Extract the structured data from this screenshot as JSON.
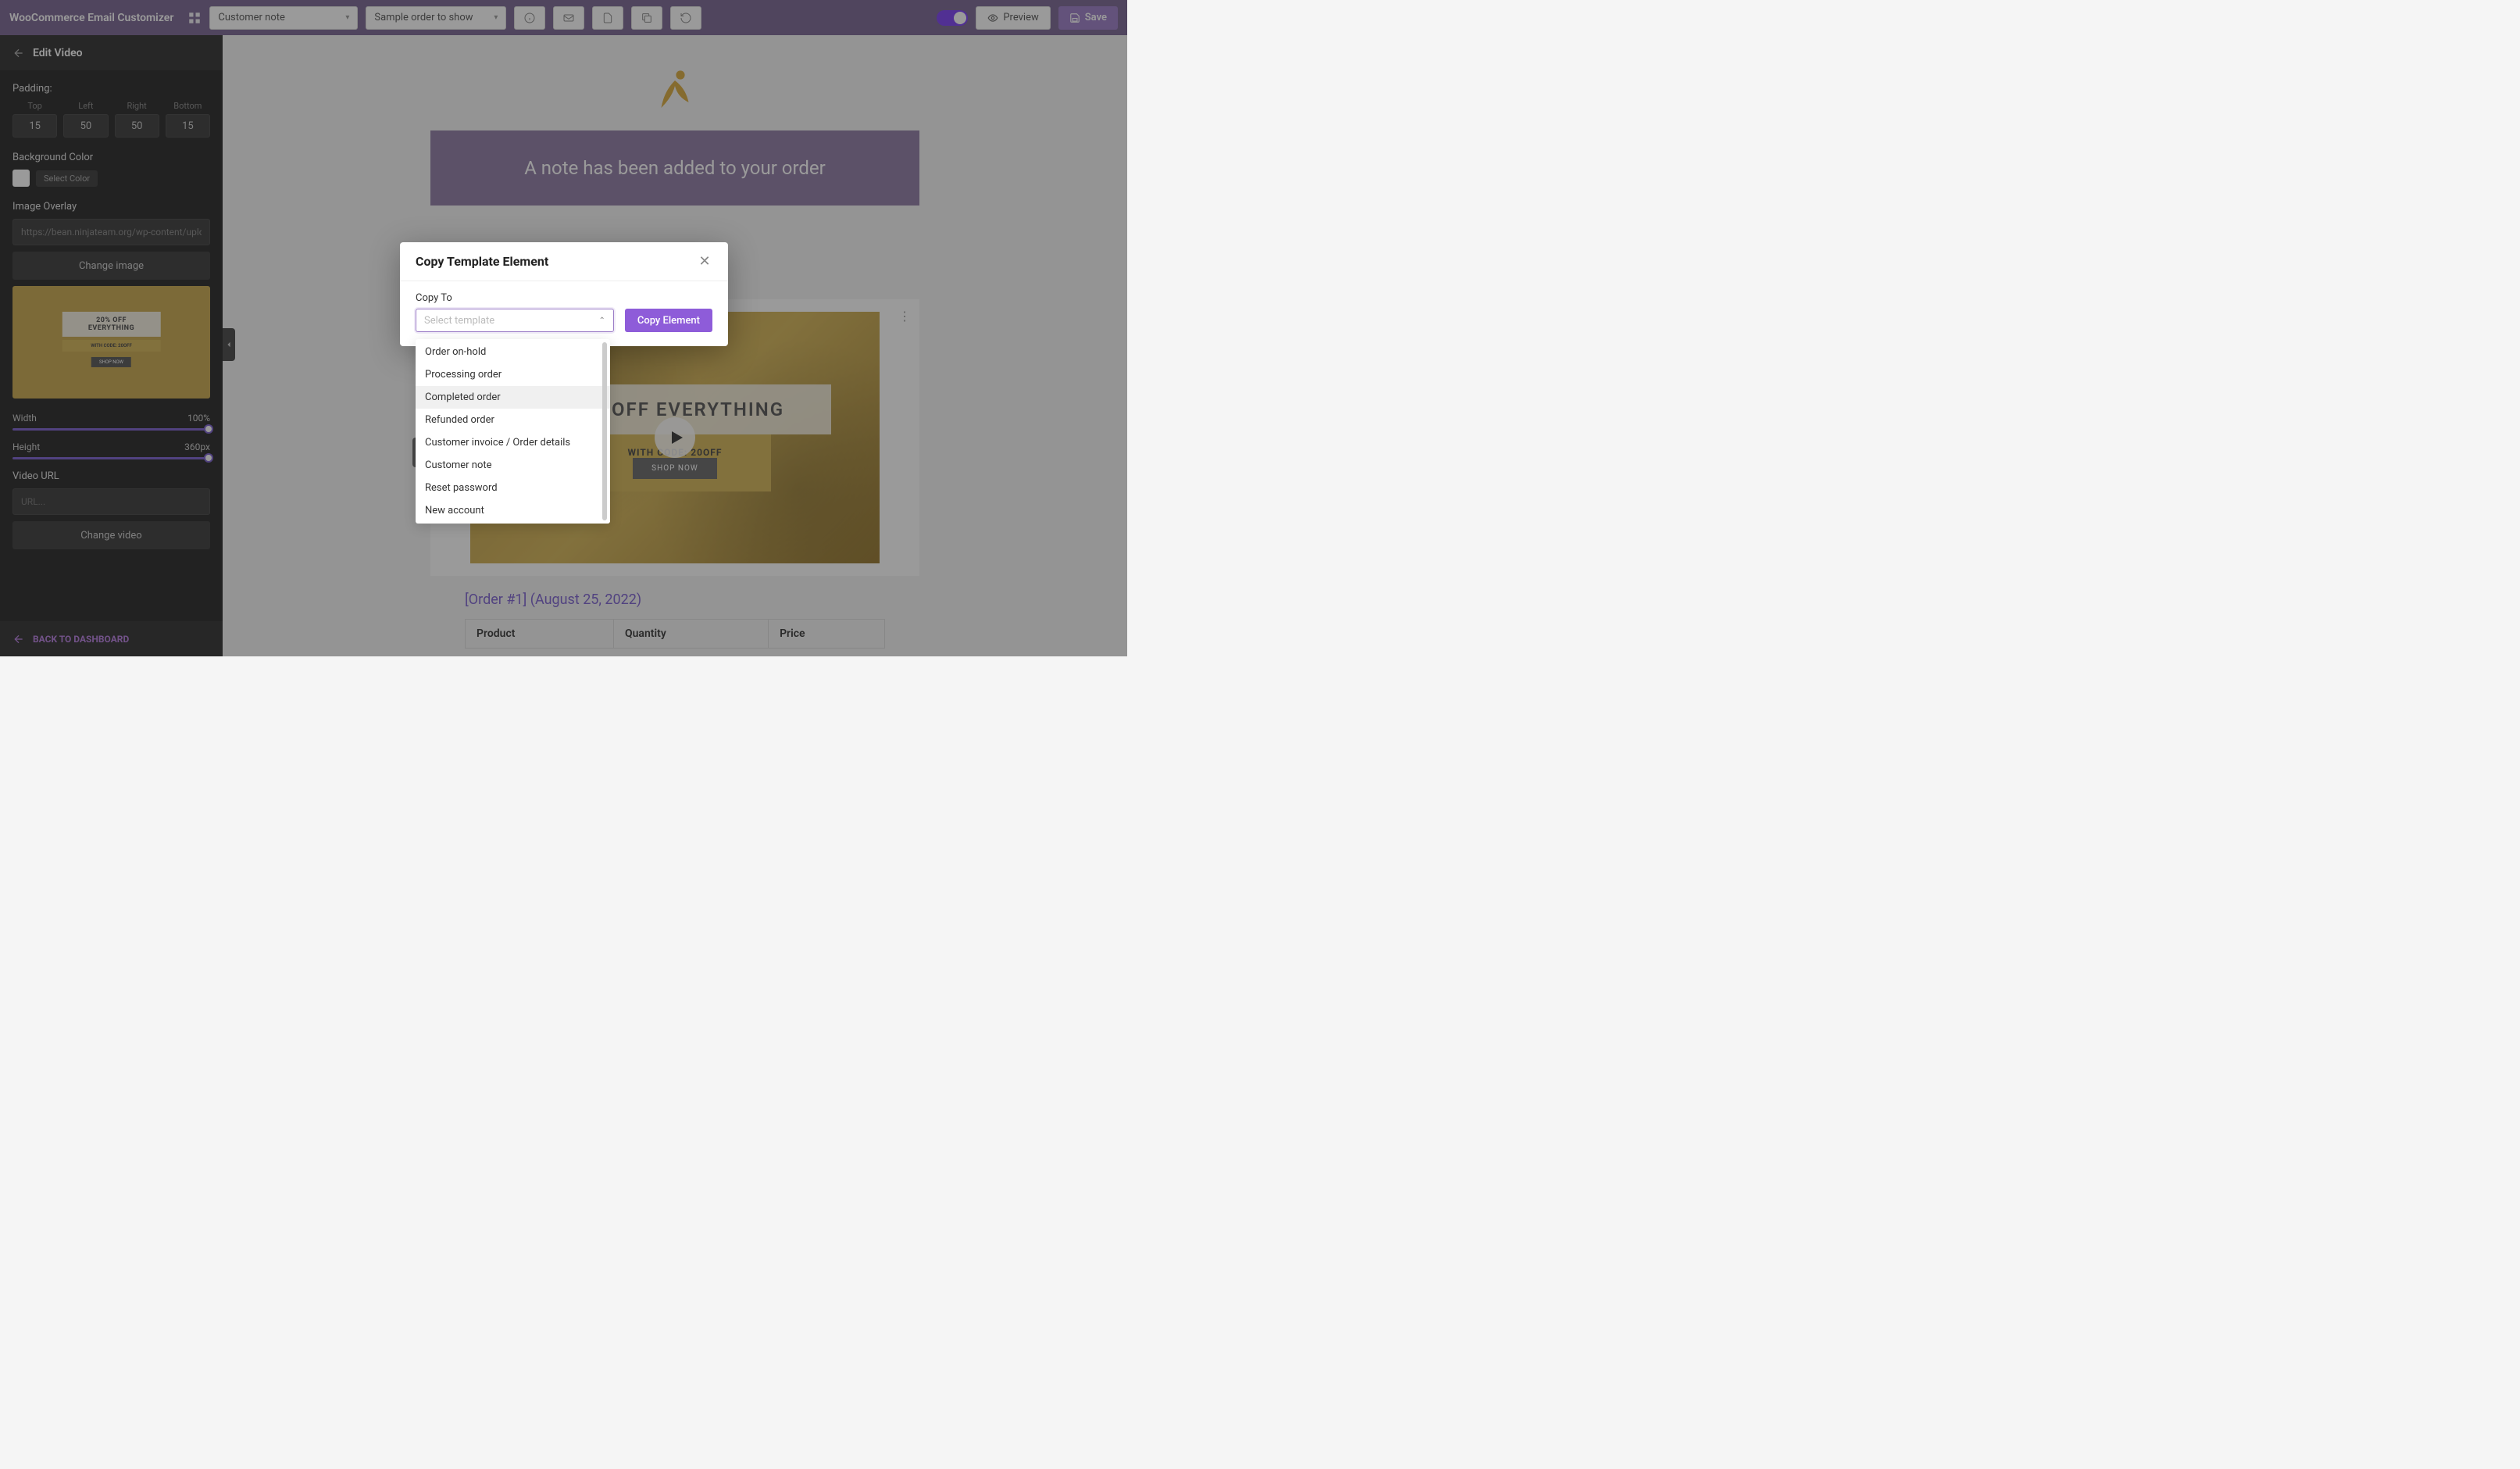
{
  "topbar": {
    "title": "WooCommerce Email Customizer",
    "template_select": "Customer note",
    "sample_select": "Sample order to show",
    "preview_label": "Preview",
    "save_label": "Save"
  },
  "sidebar": {
    "header": "Edit Video",
    "padding_label": "Padding:",
    "padding": {
      "top_label": "Top",
      "top": "15",
      "left_label": "Left",
      "left": "50",
      "right_label": "Right",
      "right": "50",
      "bottom_label": "Bottom",
      "bottom": "15"
    },
    "bg_color_label": "Background Color",
    "select_color_label": "Select Color",
    "overlay_label": "Image Overlay",
    "overlay_value": "https://bean.ninjateam.org/wp-content/uplo",
    "change_image": "Change image",
    "thumb": {
      "title": "20% OFF EVERYTHING",
      "code": "WITH CODE: 20OFF",
      "shop": "SHOP NOW"
    },
    "width_label": "Width",
    "width_value": "100%",
    "height_label": "Height",
    "height_value": "360px",
    "video_url_label": "Video URL",
    "video_url_placeholder": "URL...",
    "change_video": "Change video",
    "back_label": "BACK TO DASHBOARD"
  },
  "email": {
    "banner": "A note has been added to your order",
    "promo_title": "20% OFF EVERYTHING",
    "promo_code": "WITH CODE: 20OFF",
    "promo_shop": "SHOP NOW",
    "order_title": "[Order #1] (August 25, 2022)",
    "cols": {
      "product": "Product",
      "quantity": "Quantity",
      "price": "Price"
    }
  },
  "modal": {
    "title": "Copy Template Element",
    "copy_to_label": "Copy To",
    "placeholder": "Select template",
    "copy_btn": "Copy Element",
    "options": [
      "Order on-hold",
      "Processing order",
      "Completed order",
      "Refunded order",
      "Customer invoice / Order details",
      "Customer note",
      "Reset password",
      "New account"
    ],
    "highlighted_index": 2
  }
}
